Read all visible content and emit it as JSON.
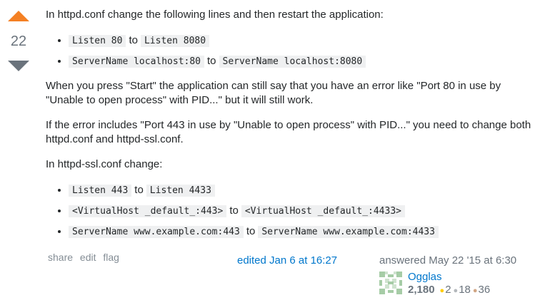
{
  "vote": {
    "count": "22"
  },
  "post": {
    "intro": "In httpd.conf change the following lines and then restart the application:",
    "list1": [
      {
        "from": "Listen 80",
        "sep": "to",
        "to": "Listen 8080"
      },
      {
        "from": "ServerName localhost:80",
        "sep": "to",
        "to": "ServerName localhost:8080"
      }
    ],
    "para2": "When you press \"Start\" the application can still say that you have an error like \"Port 80 in use by \"Unable to open process\" with PID...\" but it will still work.",
    "para3": "If the error includes \"Port 443 in use by \"Unable to open process\" with PID...\" you need to change both httpd.conf and httpd-ssl.conf.",
    "para4": "In httpd-ssl.conf change:",
    "list2": [
      {
        "from": "Listen 443",
        "sep": "to",
        "to": "Listen 4433"
      },
      {
        "from": "<VirtualHost _default_:443>",
        "sep": "to",
        "to": "<VirtualHost _default_:4433>"
      },
      {
        "from": "ServerName www.example.com:443",
        "sep": "to",
        "to": "ServerName www.example.com:4433"
      }
    ]
  },
  "menu": {
    "share": "share",
    "edit": "edit",
    "flag": "flag"
  },
  "edited": "edited Jan 6 at 16:27",
  "answered": "answered May 22 '15 at 6:30",
  "user": {
    "name": "Ogglas",
    "reputation": "2,180",
    "gold": "2",
    "silver": "18",
    "bronze": "36"
  },
  "colors": {
    "upvote": "#f48024",
    "link": "#0077cc",
    "code_bg": "#eff0f1"
  }
}
